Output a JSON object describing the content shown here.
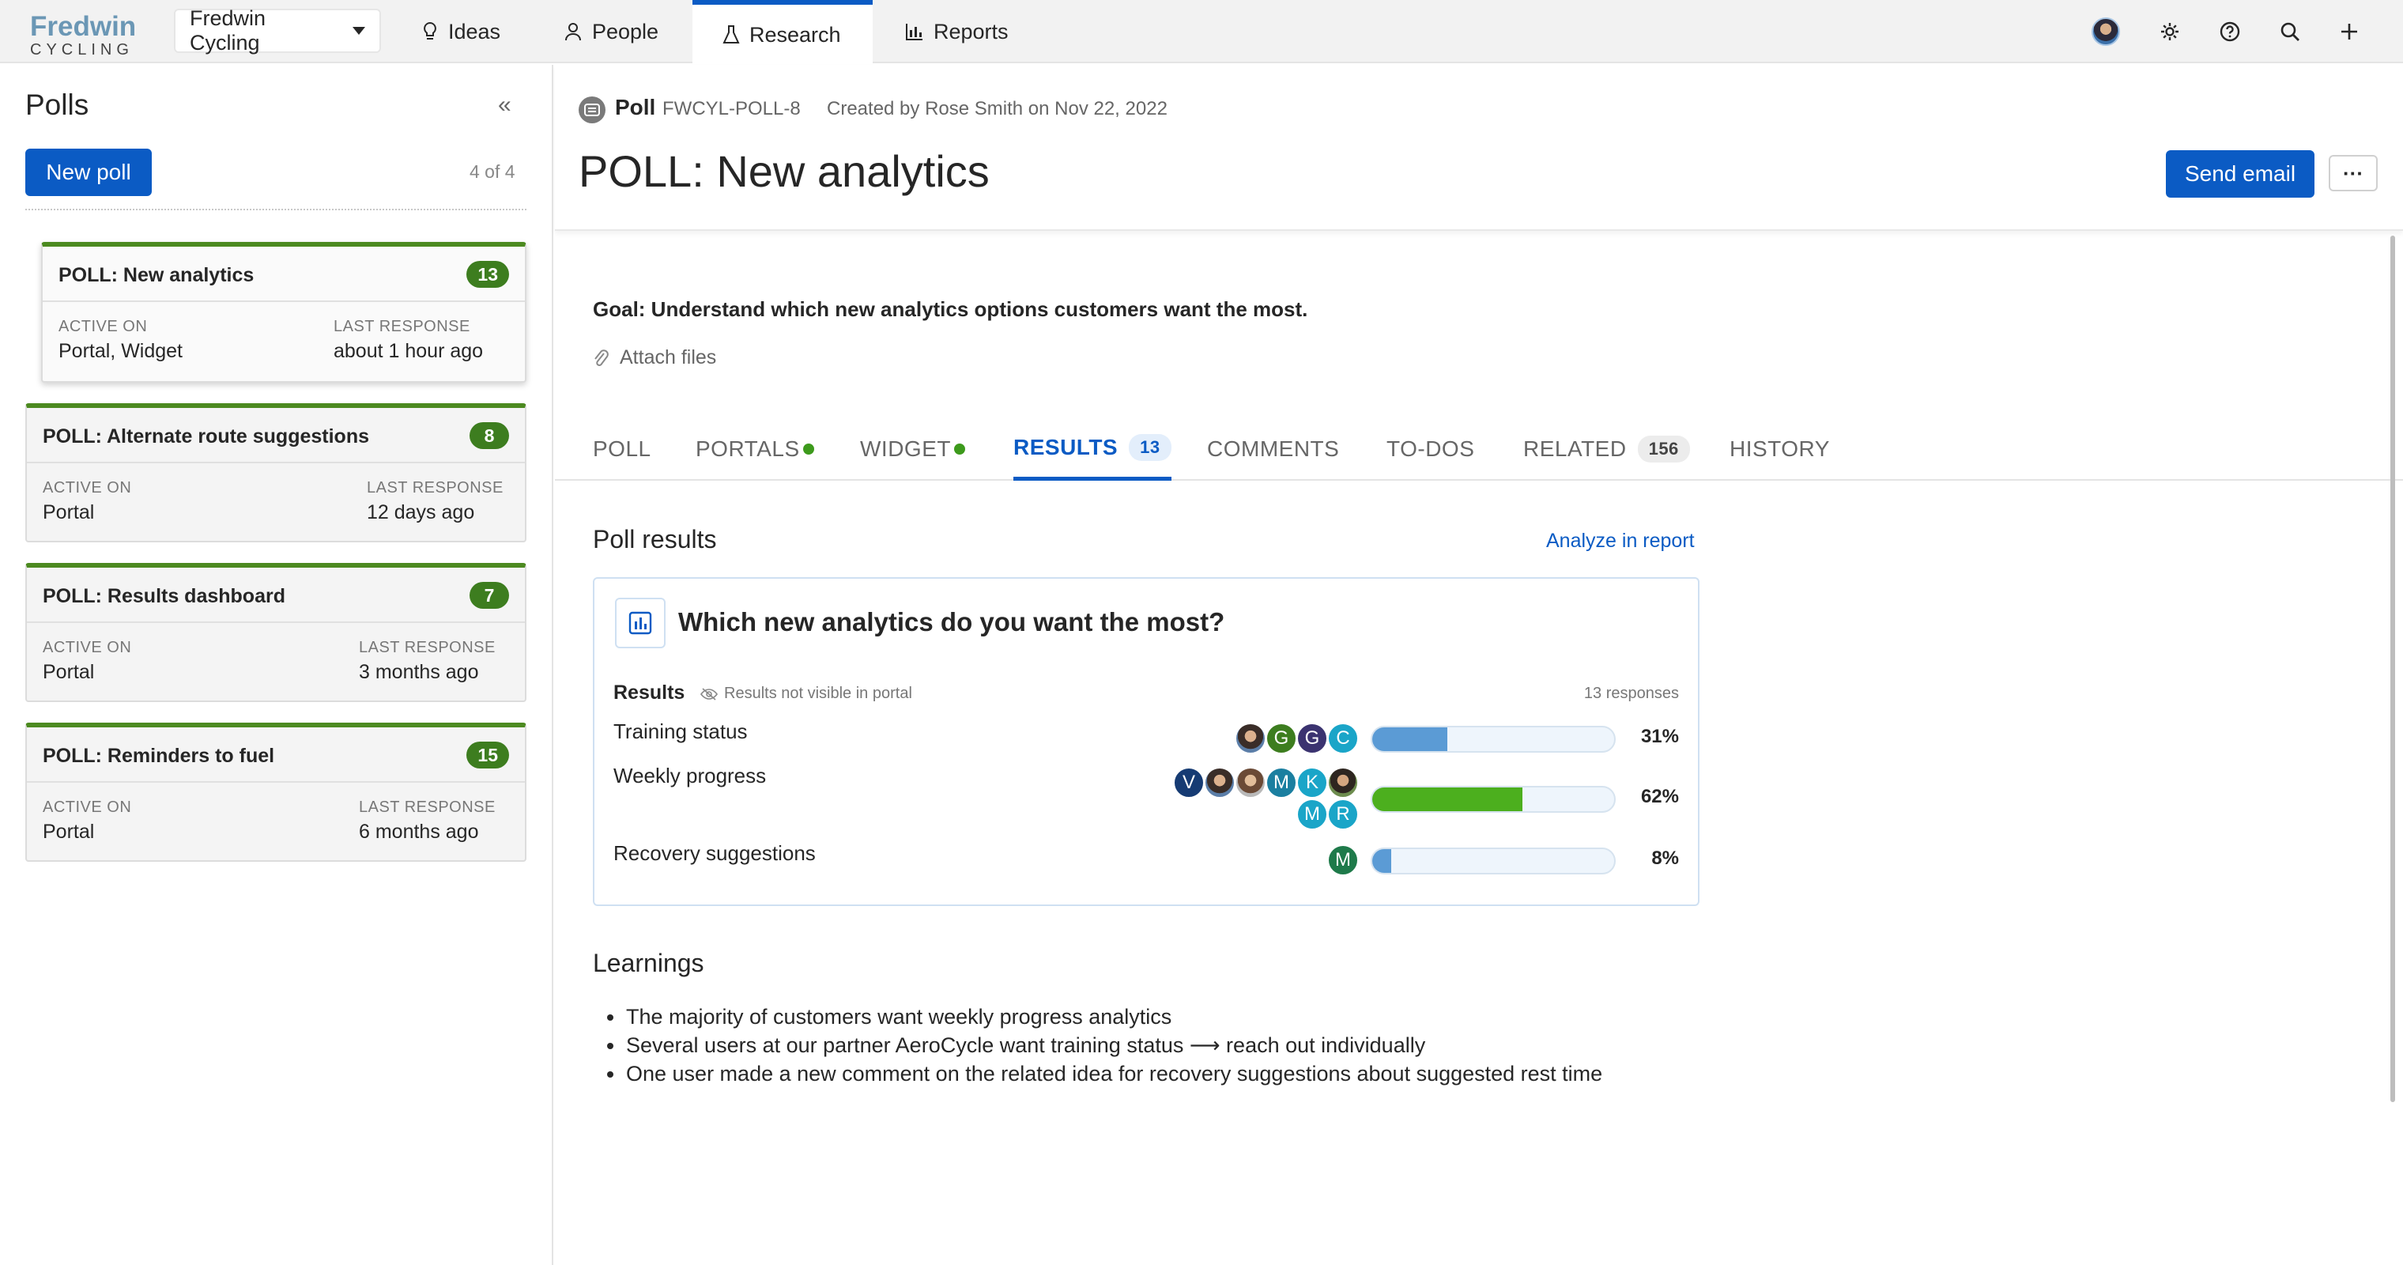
{
  "app": {
    "logo_line1": "Fredwin",
    "logo_line2": "CYCLING",
    "workspace": "Fredwin Cycling",
    "nav_tabs": [
      "Ideas",
      "People",
      "Research",
      "Reports"
    ],
    "active_tab": "Research"
  },
  "sidebar": {
    "title": "Polls",
    "new_button": "New poll",
    "count": "4 of 4",
    "cards": [
      {
        "title": "POLL: New analytics",
        "count": "13",
        "active_label": "ACTIVE ON",
        "active_value": "Portal, Widget",
        "last_label": "LAST RESPONSE",
        "last_value": "about 1 hour ago"
      },
      {
        "title": "POLL: Alternate route suggestions",
        "count": "8",
        "active_label": "ACTIVE ON",
        "active_value": "Portal",
        "last_label": "LAST RESPONSE",
        "last_value": "12 days ago"
      },
      {
        "title": "POLL: Results dashboard",
        "count": "7",
        "active_label": "ACTIVE ON",
        "active_value": "Portal",
        "last_label": "LAST RESPONSE",
        "last_value": "3 months ago"
      },
      {
        "title": "POLL: Reminders to fuel",
        "count": "15",
        "active_label": "ACTIVE ON",
        "active_value": "Portal",
        "last_label": "LAST RESPONSE",
        "last_value": "6 months ago"
      }
    ]
  },
  "record": {
    "type": "Poll",
    "id": "FWCYL-POLL-8",
    "created": "Created by Rose Smith on Nov 22, 2022",
    "title": "POLL: New analytics",
    "send_email": "Send email",
    "more": "···",
    "goal": "Goal: Understand which new analytics options customers want the most.",
    "attach": "Attach files"
  },
  "tabs": {
    "poll": "POLL",
    "portals": "PORTALS",
    "widget": "WIDGET",
    "results": "RESULTS",
    "results_count": "13",
    "comments": "COMMENTS",
    "todos": "TO-DOS",
    "related": "RELATED",
    "related_count": "156",
    "history": "HISTORY"
  },
  "results": {
    "section_title": "Poll results",
    "analyze_link": "Analyze in report",
    "question": "Which new analytics do you want the most?",
    "results_label": "Results",
    "not_visible": "Results not visible in portal",
    "responses": "13 responses",
    "options": [
      {
        "label": "Training status",
        "percent": 31,
        "percent_text": "31%",
        "color": "#5b9bd5",
        "avatars": [
          "photo",
          "G",
          "G",
          "C"
        ]
      },
      {
        "label": "Weekly progress",
        "percent": 62,
        "percent_text": "62%",
        "color": "#4caf1e",
        "avatars": [
          "V",
          "photo",
          "photo",
          "M",
          "K",
          "photo",
          "M",
          "R"
        ]
      },
      {
        "label": "Recovery suggestions",
        "percent": 8,
        "percent_text": "8%",
        "color": "#5b9bd5",
        "avatars": [
          "M"
        ]
      }
    ]
  },
  "learnings": {
    "title": "Learnings",
    "items": [
      "The majority of customers want weekly progress analytics",
      "Several users at our partner AeroCycle want training status ⟶ reach out individually",
      "One user made a new comment on the related idea for recovery suggestions about suggested rest time"
    ]
  },
  "colors": {
    "accent": "#0b5bc4",
    "badge_green": "#3d7d1f",
    "card_top": "#4c8a20"
  }
}
